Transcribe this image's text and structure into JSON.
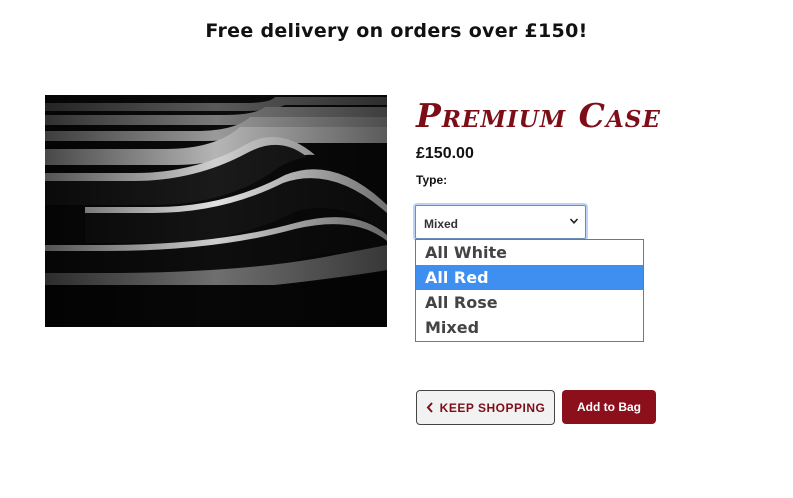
{
  "banner": {
    "text": "Free delivery on orders over £150!"
  },
  "product": {
    "title": "Premium Case",
    "price": "£150.00",
    "type_label": "Type:",
    "image_icon": "wine-bottles-photo"
  },
  "type_select": {
    "selected_value": "Mixed",
    "options": [
      "All White",
      "All Red",
      "All Rose",
      "Mixed"
    ],
    "highlighted_option": "All Red"
  },
  "actions": {
    "keep_shopping_label": "KEEP SHOPPING",
    "add_to_bag_label": "Add to Bag"
  },
  "colors": {
    "brand": "#8c0f1c",
    "highlight": "#3f8ff0"
  }
}
